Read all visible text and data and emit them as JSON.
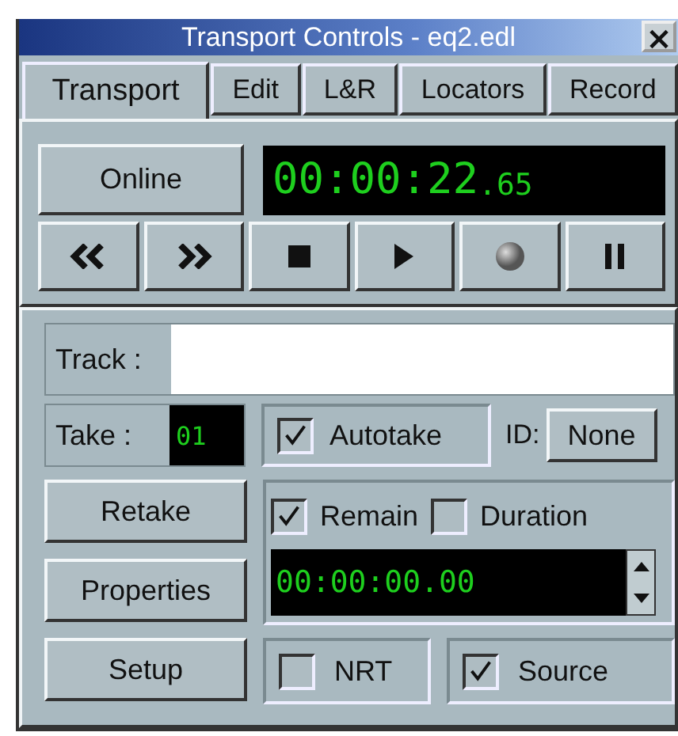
{
  "window": {
    "title": "Transport Controls - eq2.edl",
    "close": "×"
  },
  "tabs": [
    {
      "label": "Transport",
      "selected": true
    },
    {
      "label": "Edit",
      "selected": false
    },
    {
      "label": "L&R",
      "selected": false
    },
    {
      "label": "Locators",
      "selected": false
    },
    {
      "label": "Record",
      "selected": false
    }
  ],
  "online_button": "Online",
  "timecode": {
    "main": "00:00:22",
    "fraction": ".65"
  },
  "transport_buttons": [
    {
      "kind": "rewind"
    },
    {
      "kind": "forward"
    },
    {
      "kind": "stop"
    },
    {
      "kind": "play"
    },
    {
      "kind": "record"
    },
    {
      "kind": "pause"
    }
  ],
  "track": {
    "label": "Track :"
  },
  "take": {
    "label": "Take :",
    "value": "01"
  },
  "autotake": {
    "label": "Autotake",
    "checked": true
  },
  "id": {
    "label": "ID:",
    "button": "None"
  },
  "side_buttons": [
    "Retake",
    "Properties",
    "Setup"
  ],
  "remain": {
    "label": "Remain",
    "checked": true
  },
  "duration": {
    "label": "Duration",
    "checked": false
  },
  "duration_time": "00:00:00.00",
  "nrt": {
    "label": "NRT",
    "checked": false
  },
  "source": {
    "label": "Source",
    "checked": true
  }
}
